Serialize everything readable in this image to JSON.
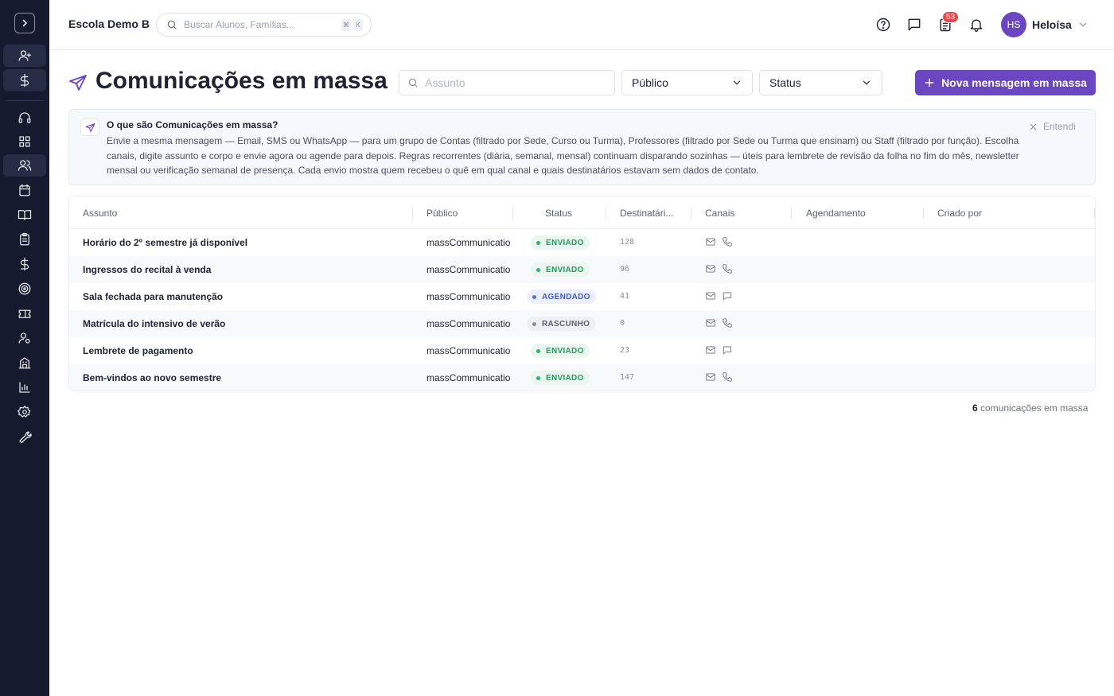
{
  "org": {
    "name": "Escola Demo B"
  },
  "global_search": {
    "placeholder": "Buscar Alunos, Famílias...",
    "kbd1": "⌘",
    "kbd2": "K"
  },
  "notifications": {
    "count": "53"
  },
  "user": {
    "initials": "HS",
    "name": "Heloísa"
  },
  "page": {
    "title": "Comunicações em massa"
  },
  "filters": {
    "search_placeholder": "Assunto",
    "audience": "Público",
    "status": "Status"
  },
  "actions": {
    "new_label": "Nova mensagem em massa"
  },
  "info": {
    "title": "O que são Comunicações em massa?",
    "body": "Envie a mesma mensagem — Email, SMS ou WhatsApp — para um grupo de Contas (filtrado por Sede, Curso ou Turma), Professores (filtrado por Sede ou Turma que ensinam) ou Staff (filtrado por função). Escolha canais, digite assunto e corpo e envie agora ou agende para depois. Regras recorrentes (diária, semanal, mensal) continuam disparando sozinhas — úteis para lembrete de revisão da folha no fim do mês, newsletter mensal ou verificação semanal de presença. Cada envio mostra quem recebeu o quê em qual canal e quais destinatários estavam sem dados de contato.",
    "dismiss": "Entendi"
  },
  "table": {
    "columns": [
      "Assunto",
      "Público",
      "Status",
      "Destinatári...",
      "Canais",
      "Agendamento",
      "Criado por"
    ],
    "rows": [
      {
        "subject": "Horário do 2º semestre já disponível",
        "audience": "massCommunicatio",
        "status": "ENVIADO",
        "recipients": "128",
        "channels": [
          "email-icon",
          "phone-icon"
        ]
      },
      {
        "subject": "Ingressos do recital à venda",
        "audience": "massCommunicatio",
        "status": "ENVIADO",
        "recipients": "96",
        "channels": [
          "email-icon",
          "phone-icon"
        ]
      },
      {
        "subject": "Sala fechada para manutenção",
        "audience": "massCommunicatio",
        "status": "AGENDADO",
        "recipients": "41",
        "channels": [
          "email-icon",
          "chat-icon"
        ]
      },
      {
        "subject": "Matrícula do intensivo de verão",
        "audience": "massCommunicatio",
        "status": "RASCUNHO",
        "recipients": "0",
        "channels": [
          "email-icon",
          "phone-icon"
        ]
      },
      {
        "subject": "Lembrete de pagamento",
        "audience": "massCommunicatio",
        "status": "ENVIADO",
        "recipients": "23",
        "channels": [
          "email-icon",
          "chat-icon"
        ]
      },
      {
        "subject": "Bem-vindos ao novo semestre",
        "audience": "massCommunicatio",
        "status": "ENVIADO",
        "recipients": "147",
        "channels": [
          "email-icon",
          "phone-icon"
        ]
      }
    ]
  },
  "footer": {
    "count": "6",
    "label": "comunicações em massa"
  },
  "colors": {
    "accent": "#6b46c1",
    "sidebar": "#151a2e",
    "sent": "#1e9e5a",
    "scheduled": "#3b5bdb",
    "draft": "#5b5f70"
  }
}
